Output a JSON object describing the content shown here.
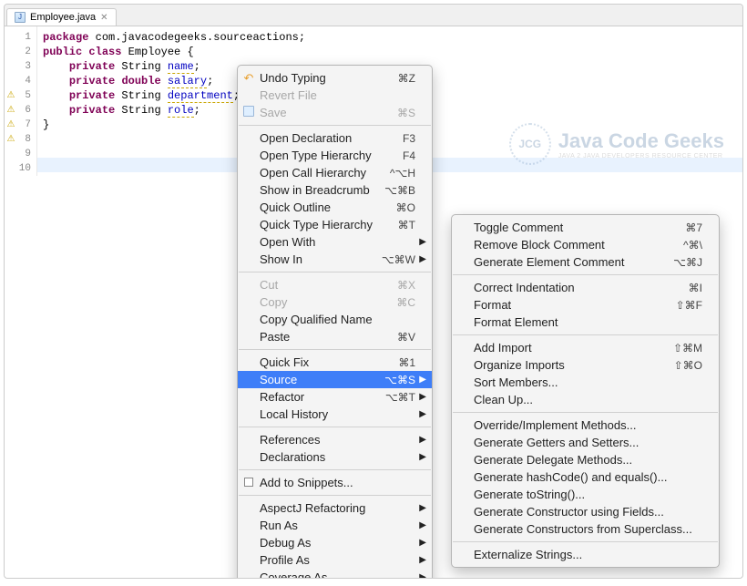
{
  "tab": {
    "filename": "Employee.java"
  },
  "code": {
    "lines": [
      "package com.javacodegeeks.sourceactions;",
      "",
      "public class Employee {",
      "",
      "    private String name;",
      "    private double salary;",
      "    private String department;",
      "    private String role;",
      "",
      "}"
    ],
    "keywords": {
      "package": 1,
      "public": 1,
      "class": 1,
      "private": 1,
      "double": 1
    },
    "types": {
      "String": 1,
      "Employee": 1
    },
    "fields": {
      "name": 1,
      "salary": 1,
      "department": 1,
      "role": 1
    }
  },
  "gutterMarkers": [
    5,
    6,
    7,
    8
  ],
  "highlightLine": 10,
  "watermark": {
    "logoText": "JCG",
    "main": "Java Code Geeks",
    "sub": "JAVA 2 JAVA DEVELOPERS RESOURCE CENTER"
  },
  "menuMain": [
    {
      "type": "item",
      "label": "Undo Typing",
      "shortcut": "⌘Z",
      "icon": "undo"
    },
    {
      "type": "item",
      "label": "Revert File",
      "disabled": true
    },
    {
      "type": "item",
      "label": "Save",
      "shortcut": "⌘S",
      "disabled": true,
      "icon": "save"
    },
    {
      "type": "sep"
    },
    {
      "type": "item",
      "label": "Open Declaration",
      "shortcut": "F3"
    },
    {
      "type": "item",
      "label": "Open Type Hierarchy",
      "shortcut": "F4"
    },
    {
      "type": "item",
      "label": "Open Call Hierarchy",
      "shortcut": "^⌥H"
    },
    {
      "type": "item",
      "label": "Show in Breadcrumb",
      "shortcut": "⌥⌘B"
    },
    {
      "type": "item",
      "label": "Quick Outline",
      "shortcut": "⌘O"
    },
    {
      "type": "item",
      "label": "Quick Type Hierarchy",
      "shortcut": "⌘T"
    },
    {
      "type": "item",
      "label": "Open With",
      "submenu": true
    },
    {
      "type": "item",
      "label": "Show In",
      "shortcut": "⌥⌘W",
      "submenu": true
    },
    {
      "type": "sep"
    },
    {
      "type": "item",
      "label": "Cut",
      "shortcut": "⌘X",
      "disabled": true
    },
    {
      "type": "item",
      "label": "Copy",
      "shortcut": "⌘C",
      "disabled": true
    },
    {
      "type": "item",
      "label": "Copy Qualified Name"
    },
    {
      "type": "item",
      "label": "Paste",
      "shortcut": "⌘V"
    },
    {
      "type": "sep"
    },
    {
      "type": "item",
      "label": "Quick Fix",
      "shortcut": "⌘1"
    },
    {
      "type": "item",
      "label": "Source",
      "shortcut": "⌥⌘S",
      "submenu": true,
      "selected": true
    },
    {
      "type": "item",
      "label": "Refactor",
      "shortcut": "⌥⌘T",
      "submenu": true
    },
    {
      "type": "item",
      "label": "Local History",
      "submenu": true
    },
    {
      "type": "sep"
    },
    {
      "type": "item",
      "label": "References",
      "submenu": true
    },
    {
      "type": "item",
      "label": "Declarations",
      "submenu": true
    },
    {
      "type": "sep"
    },
    {
      "type": "item",
      "label": "Add to Snippets...",
      "icon": "snip"
    },
    {
      "type": "sep"
    },
    {
      "type": "item",
      "label": "AspectJ Refactoring",
      "submenu": true
    },
    {
      "type": "item",
      "label": "Run As",
      "submenu": true
    },
    {
      "type": "item",
      "label": "Debug As",
      "submenu": true
    },
    {
      "type": "item",
      "label": "Profile As",
      "submenu": true
    },
    {
      "type": "item",
      "label": "Coverage As",
      "submenu": true
    }
  ],
  "menuSub": [
    {
      "type": "item",
      "label": "Toggle Comment",
      "shortcut": "⌘7"
    },
    {
      "type": "item",
      "label": "Remove Block Comment",
      "shortcut": "^⌘\\"
    },
    {
      "type": "item",
      "label": "Generate Element Comment",
      "shortcut": "⌥⌘J"
    },
    {
      "type": "sep"
    },
    {
      "type": "item",
      "label": "Correct Indentation",
      "shortcut": "⌘I"
    },
    {
      "type": "item",
      "label": "Format",
      "shortcut": "⇧⌘F"
    },
    {
      "type": "item",
      "label": "Format Element"
    },
    {
      "type": "sep"
    },
    {
      "type": "item",
      "label": "Add Import",
      "shortcut": "⇧⌘M"
    },
    {
      "type": "item",
      "label": "Organize Imports",
      "shortcut": "⇧⌘O"
    },
    {
      "type": "item",
      "label": "Sort Members..."
    },
    {
      "type": "item",
      "label": "Clean Up..."
    },
    {
      "type": "sep"
    },
    {
      "type": "item",
      "label": "Override/Implement Methods..."
    },
    {
      "type": "item",
      "label": "Generate Getters and Setters..."
    },
    {
      "type": "item",
      "label": "Generate Delegate Methods..."
    },
    {
      "type": "item",
      "label": "Generate hashCode() and equals()..."
    },
    {
      "type": "item",
      "label": "Generate toString()..."
    },
    {
      "type": "item",
      "label": "Generate Constructor using Fields..."
    },
    {
      "type": "item",
      "label": "Generate Constructors from Superclass..."
    },
    {
      "type": "sep"
    },
    {
      "type": "item",
      "label": "Externalize Strings..."
    }
  ]
}
